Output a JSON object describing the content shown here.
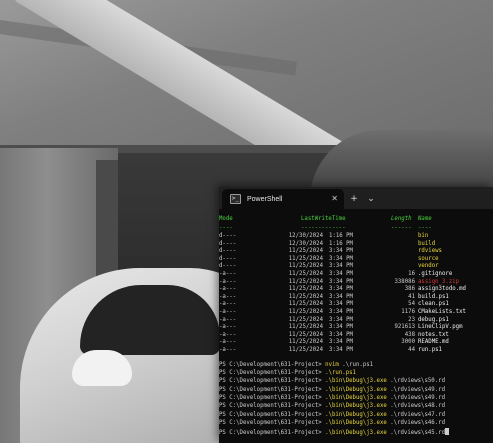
{
  "terminal": {
    "tab_title": "PowerShell",
    "tab_icon_glyph": ">_",
    "new_tab_glyph": "+",
    "dropdown_glyph": "⌄",
    "close_glyph": "✕",
    "headers": {
      "mode": "Mode",
      "last_write_time": "LastWriteTime",
      "length": "Length",
      "name": "Name"
    },
    "separators": {
      "mode": "----",
      "last_write_time": "-------------",
      "length": "------",
      "name": "----"
    },
    "entries": [
      {
        "mode": "d----",
        "date": "12/30/2024",
        "time": "1:16 PM",
        "length": "",
        "name": "bin",
        "kind": "dir"
      },
      {
        "mode": "d----",
        "date": "12/30/2024",
        "time": "1:16 PM",
        "length": "",
        "name": "build",
        "kind": "dir"
      },
      {
        "mode": "d----",
        "date": "11/25/2024",
        "time": "3:34 PM",
        "length": "",
        "name": "rdviews",
        "kind": "dir"
      },
      {
        "mode": "d----",
        "date": "11/25/2024",
        "time": "3:34 PM",
        "length": "",
        "name": "source",
        "kind": "dir"
      },
      {
        "mode": "d----",
        "date": "11/25/2024",
        "time": "3:34 PM",
        "length": "",
        "name": "vendor",
        "kind": "dir"
      },
      {
        "mode": "-a---",
        "date": "11/25/2024",
        "time": "3:34 PM",
        "length": "16",
        "name": ".gitignore",
        "kind": "file"
      },
      {
        "mode": "-a---",
        "date": "11/25/2024",
        "time": "3:34 PM",
        "length": "338086",
        "name": "assign_3.zip",
        "kind": "zip"
      },
      {
        "mode": "-a---",
        "date": "11/25/2024",
        "time": "3:34 PM",
        "length": "386",
        "name": "assign3todo.md",
        "kind": "file"
      },
      {
        "mode": "-a---",
        "date": "11/25/2024",
        "time": "3:34 PM",
        "length": "41",
        "name": "build.ps1",
        "kind": "file"
      },
      {
        "mode": "-a---",
        "date": "11/25/2024",
        "time": "3:34 PM",
        "length": "54",
        "name": "clean.ps1",
        "kind": "file"
      },
      {
        "mode": "-a---",
        "date": "11/25/2024",
        "time": "3:34 PM",
        "length": "1176",
        "name": "CMakeLists.txt",
        "kind": "file"
      },
      {
        "mode": "-a---",
        "date": "11/25/2024",
        "time": "3:34 PM",
        "length": "23",
        "name": "debug.ps1",
        "kind": "file"
      },
      {
        "mode": "-a---",
        "date": "11/25/2024",
        "time": "3:34 PM",
        "length": "921613",
        "name": "LineClipV.pgm",
        "kind": "file"
      },
      {
        "mode": "-a---",
        "date": "11/25/2024",
        "time": "3:34 PM",
        "length": "438",
        "name": "notes.txt",
        "kind": "file"
      },
      {
        "mode": "-a---",
        "date": "11/25/2024",
        "time": "3:34 PM",
        "length": "3000",
        "name": "README.md",
        "kind": "file"
      },
      {
        "mode": "-a---",
        "date": "11/25/2024",
        "time": "3:34 PM",
        "length": "44",
        "name": "run.ps1",
        "kind": "file"
      }
    ],
    "prompt_lines": [
      {
        "prompt": "PS C:\\Development\\631-Project> ",
        "cmd": "nvim",
        "args": " .\\run.ps1"
      },
      {
        "prompt": "PS C:\\Development\\631-Project> ",
        "cmd": ".\\run.ps1",
        "args": ""
      },
      {
        "prompt": "PS C:\\Development\\631-Project> ",
        "cmd": ".\\bin\\Debug\\j3.exe",
        "args": " .\\rdviews\\s50.rd"
      },
      {
        "prompt": "PS C:\\Development\\631-Project> ",
        "cmd": ".\\bin\\Debug\\j3.exe",
        "args": " .\\rdviews\\s49.rd"
      },
      {
        "prompt": "PS C:\\Development\\631-Project> ",
        "cmd": ".\\bin\\Debug\\j3.exe",
        "args": " .\\rdviews\\s49.rd"
      },
      {
        "prompt": "PS C:\\Development\\631-Project> ",
        "cmd": ".\\bin\\Debug\\j3.exe",
        "args": " .\\rdviews\\s48.rd"
      },
      {
        "prompt": "PS C:\\Development\\631-Project> ",
        "cmd": ".\\bin\\Debug\\j3.exe",
        "args": " .\\rdviews\\s47.rd"
      },
      {
        "prompt": "PS C:\\Development\\631-Project> ",
        "cmd": ".\\bin\\Debug\\j3.exe",
        "args": " .\\rdviews\\s46.rd"
      },
      {
        "prompt": "PS C:\\Development\\631-Project> ",
        "cmd": ".\\bin\\Debug\\j3.exe",
        "args": " .\\rdviews\\s45.rd"
      }
    ]
  },
  "colors": {
    "terminal_bg": "#0c0c0c",
    "header_green": "#48d33c",
    "dir_yellow": "#e8d53a",
    "zip_red": "#d23b3b",
    "text": "#cccccc"
  }
}
